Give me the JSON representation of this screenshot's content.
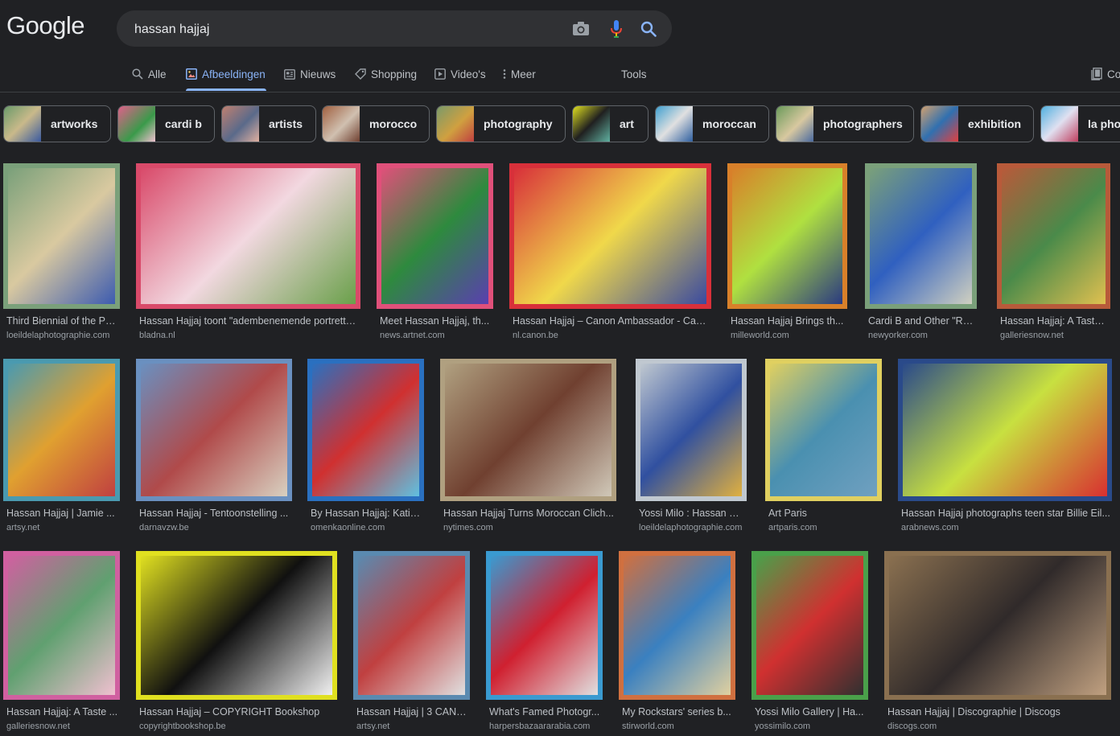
{
  "header": {
    "logo": "Google",
    "search_value": "hassan hajjaj"
  },
  "tabs": [
    {
      "label": "Alle",
      "icon": "search-icon"
    },
    {
      "label": "Afbeeldingen",
      "icon": "image-icon",
      "active": true
    },
    {
      "label": "Nieuws",
      "icon": "news-icon"
    },
    {
      "label": "Shopping",
      "icon": "tag-icon"
    },
    {
      "label": "Video's",
      "icon": "play-icon"
    },
    {
      "label": "Meer",
      "icon": "more-vert-icon"
    },
    {
      "label": "Tools"
    },
    {
      "label": "Co",
      "icon": "collections-icon"
    }
  ],
  "chips": [
    {
      "label": "artworks"
    },
    {
      "label": "cardi b"
    },
    {
      "label": "artists"
    },
    {
      "label": "morocco"
    },
    {
      "label": "photography"
    },
    {
      "label": "art"
    },
    {
      "label": "moroccan"
    },
    {
      "label": "photographers"
    },
    {
      "label": "exhibition"
    },
    {
      "label": "la pho"
    }
  ],
  "results": [
    {
      "title": "Third Biennial of the Ph...",
      "source": "loeildelaphotographie.com",
      "colors": [
        "#7aa07a",
        "#d9c9a0",
        "#3c5bb0"
      ]
    },
    {
      "title": "Hassan Hajjaj toont \"adembenemende portrette...",
      "source": "bladna.nl",
      "colors": [
        "#d94a6a",
        "#f2d8e0",
        "#6aa04a"
      ]
    },
    {
      "title": "Meet Hassan Hajjaj, th...",
      "source": "news.artnet.com",
      "colors": [
        "#e0507a",
        "#2e8a3e",
        "#5a3fb0"
      ]
    },
    {
      "title": "Hassan Hajjaj – Canon Ambassador - Can...",
      "source": "nl.canon.be",
      "colors": [
        "#d8303a",
        "#f0d84a",
        "#3a4aa0"
      ]
    },
    {
      "title": "Hassan Hajjaj Brings th...",
      "source": "milleworld.com",
      "colors": [
        "#d8802a",
        "#b0e040",
        "#2a3a80"
      ]
    },
    {
      "title": "Cardi B and Other \"Roc...",
      "source": "newyorker.com",
      "colors": [
        "#7aa07a",
        "#3060c0",
        "#d0d0c0"
      ]
    },
    {
      "title": "Hassan Hajjaj: A Taste ...",
      "source": "galleriesnow.net",
      "colors": [
        "#b85a3a",
        "#4a8a4a",
        "#e0c050"
      ]
    },
    {
      "title": "Hassan Hajjaj | Jamie ...",
      "source": "artsy.net",
      "colors": [
        "#4a9ab0",
        "#e0a030",
        "#c04040"
      ]
    },
    {
      "title": "Hassan Hajjaj - Tentoonstelling ...",
      "source": "darnavzw.be",
      "colors": [
        "#6a90c0",
        "#b04a4a",
        "#d8d0c0"
      ]
    },
    {
      "title": "By Hassan Hajjaj: Katia...",
      "source": "omenkaonline.com",
      "colors": [
        "#2a70c0",
        "#d03030",
        "#60c0e0"
      ]
    },
    {
      "title": "Hassan Hajjaj Turns Moroccan Clich...",
      "source": "nytimes.com",
      "colors": [
        "#b0a080",
        "#704030",
        "#d0c8b8"
      ]
    },
    {
      "title": "Yossi Milo : Hassan Ha...",
      "source": "loeildelaphotographie.com",
      "colors": [
        "#c0c8d0",
        "#3050a0",
        "#e0b040"
      ]
    },
    {
      "title": "Art Paris",
      "source": "artparis.com",
      "colors": [
        "#e0d060",
        "#4a90b0",
        "#70a0c0"
      ]
    },
    {
      "title": "Hassan Hajjaj photographs teen star Billie Eil...",
      "source": "arabnews.com",
      "colors": [
        "#2a4a8a",
        "#c8e040",
        "#d83030"
      ]
    },
    {
      "title": "Hassan Hajjaj: A Taste ...",
      "source": "galleriesnow.net",
      "colors": [
        "#d060a0",
        "#60a070",
        "#f0c0d0"
      ]
    },
    {
      "title": "Hassan Hajjaj – COPYRIGHT Bookshop",
      "source": "copyrightbookshop.be",
      "colors": [
        "#e0e020",
        "#101010",
        "#f0f0f0"
      ]
    },
    {
      "title": "Hassan Hajjaj | 3 CANA...",
      "source": "artsy.net",
      "colors": [
        "#5a8ab0",
        "#c04040",
        "#e0e0e0"
      ]
    },
    {
      "title": "What's Famed Photogr...",
      "source": "harpersbazaararabia.com",
      "colors": [
        "#3a9ad0",
        "#d02030",
        "#e0e0e0"
      ]
    },
    {
      "title": "My Rockstars' series b...",
      "source": "stirworld.com",
      "colors": [
        "#d07040",
        "#3a80c0",
        "#e0d0a0"
      ]
    },
    {
      "title": "Yossi Milo Gallery | Ha...",
      "source": "yossimilo.com",
      "colors": [
        "#4aa04a",
        "#d03030",
        "#303030"
      ]
    },
    {
      "title": "Hassan Hajjaj | Discographie | Discogs",
      "source": "discogs.com",
      "colors": [
        "#8a7050",
        "#302a2a",
        "#c0a080"
      ]
    }
  ]
}
